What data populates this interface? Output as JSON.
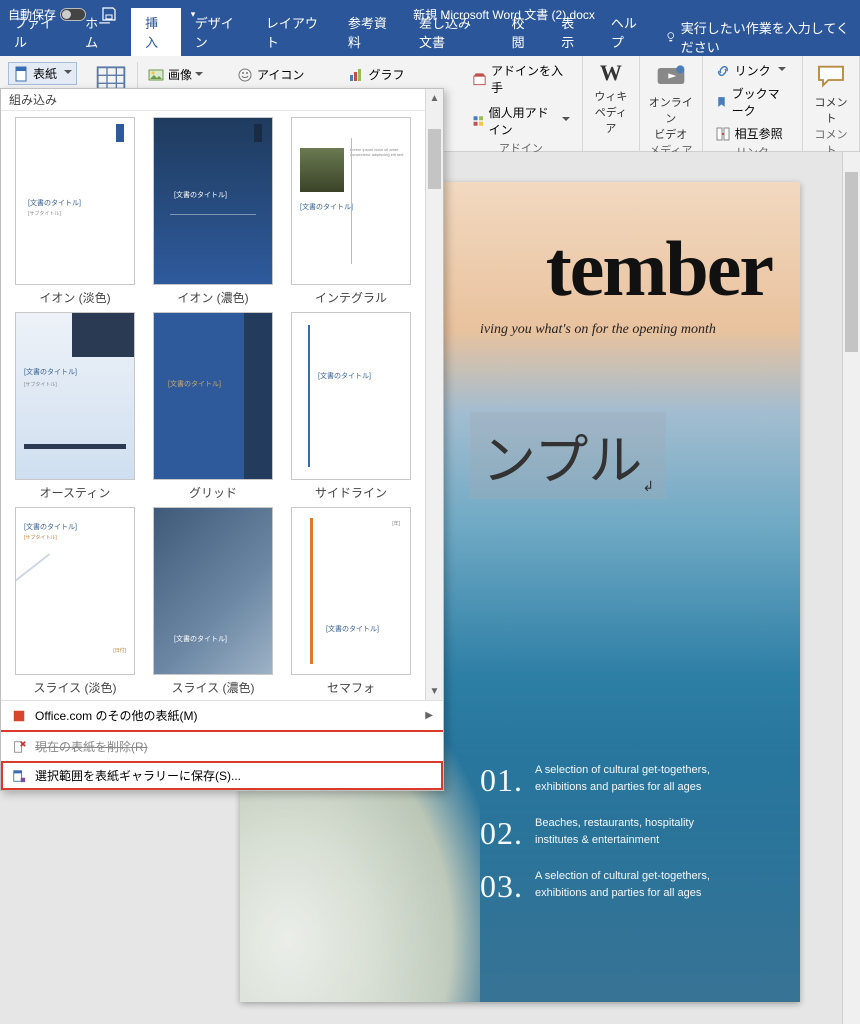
{
  "titlebar": {
    "autosave_label": "自動保存",
    "autosave_state": "オフ",
    "doc_title": "新規 Microsoft Word 文書 (2).docx"
  },
  "tabs": {
    "file": "ファイル",
    "home": "ホーム",
    "insert": "挿入",
    "design": "デザイン",
    "layout": "レイアウト",
    "references": "参考資料",
    "mailings": "差し込み文書",
    "review": "校閲",
    "view": "表示",
    "help": "ヘルプ",
    "tellme": "実行したい作業を入力してください"
  },
  "ribbon": {
    "cover_page": "表紙",
    "table": "表",
    "images": "画像",
    "icons": "アイコン",
    "chart": "グラフ",
    "get_addins": "アドインを入手",
    "my_addins": "個人用アドイン",
    "addins_group": "アドイン",
    "wikipedia_line1": "ウィキ",
    "wikipedia_line2": "ペディア",
    "online_video_line1": "オンライン",
    "online_video_line2": "ビデオ",
    "media_group": "メディア",
    "links_link": "リンク",
    "links_bookmark": "ブックマーク",
    "links_crossref": "相互参照",
    "links_group": "リンク",
    "comment": "コメント",
    "comment_group": "コメント"
  },
  "gallery": {
    "header": "組み込み",
    "items": [
      {
        "caption": "イオン (淡色)",
        "title": "[文書のタイトル]"
      },
      {
        "caption": "イオン (濃色)",
        "title": "[文書のタイトル]"
      },
      {
        "caption": "インテグラル",
        "title": "[文書のタイトル]"
      },
      {
        "caption": "オースティン",
        "title": "[文書のタイトル]"
      },
      {
        "caption": "グリッド",
        "title": "[文書のタイトル]"
      },
      {
        "caption": "サイドライン",
        "title": "[文書のタイトル]"
      },
      {
        "caption": "スライス (淡色)",
        "title": "[文書のタイトル]"
      },
      {
        "caption": "スライス (濃色)",
        "title": "[文書のタイトル]"
      },
      {
        "caption": "セマフォ",
        "title": "[文書のタイトル]"
      }
    ],
    "menu_office": "Office.com のその他の表紙(M)",
    "menu_remove": "現在の表紙を削除(R)",
    "menu_save": "選択範囲を表紙ギャラリーに保存(S)..."
  },
  "document": {
    "heading_partial": "tember",
    "subheading_partial": "iving you what's on for the opening month",
    "sample_text": "ンプル",
    "list": [
      {
        "num": "01.",
        "line1": "A selection of cultural get-togethers,",
        "line2": "exhibitions and parties for all ages"
      },
      {
        "num": "02.",
        "line1": "Beaches, restaurants, hospitality",
        "line2": "institutes & entertainment"
      },
      {
        "num": "03.",
        "line1": "A selection of cultural get-togethers,",
        "line2": "exhibitions and parties for all ages"
      }
    ]
  }
}
